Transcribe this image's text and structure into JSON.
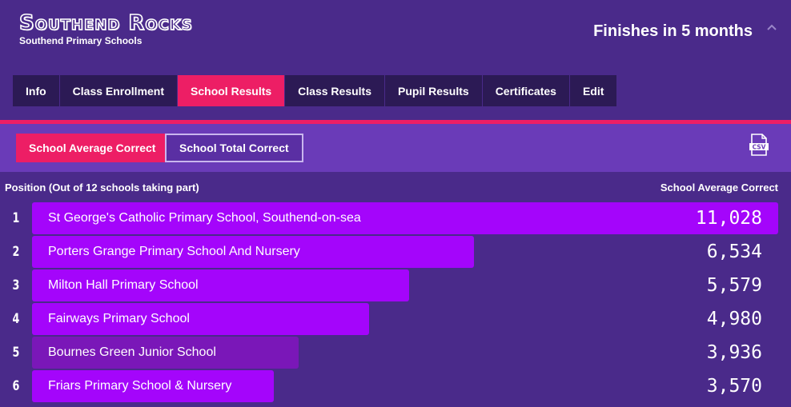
{
  "header": {
    "title": "Southend Rocks",
    "subtitle": "Southend Primary Schools",
    "finishes": "Finishes in 5 months"
  },
  "tabs": [
    {
      "label": "Info"
    },
    {
      "label": "Class Enrollment"
    },
    {
      "label": "School Results",
      "active": true
    },
    {
      "label": "Class Results"
    },
    {
      "label": "Pupil Results"
    },
    {
      "label": "Certificates"
    },
    {
      "label": "Edit"
    }
  ],
  "toolbar": {
    "average_label": "School Average Correct",
    "total_label": "School Total Correct",
    "export_icon": "csv-icon"
  },
  "list": {
    "position_header": "Position (Out of 12 schools taking part)",
    "value_header": "School Average Correct",
    "rows": [
      {
        "position": "1",
        "name": "St George's Catholic Primary School, Southend-on-sea",
        "value": "11,028",
        "amount": 11028
      },
      {
        "position": "2",
        "name": "Porters Grange Primary School And Nursery",
        "value": "6,534",
        "amount": 6534
      },
      {
        "position": "3",
        "name": "Milton Hall Primary School",
        "value": "5,579",
        "amount": 5579
      },
      {
        "position": "4",
        "name": "Fairways Primary School",
        "value": "4,980",
        "amount": 4980
      },
      {
        "position": "5",
        "name": "Bournes Green Junior School",
        "value": "3,936",
        "amount": 3936
      },
      {
        "position": "6",
        "name": "Friars Primary School & Nursery",
        "value": "3,570",
        "amount": 3570
      }
    ]
  },
  "colors": {
    "background": "#4a2a8a",
    "accent": "#ed1e65",
    "bar": "#a405fb",
    "bar_highlight": "#7a17b8",
    "tab_bg": "#2c1a55"
  }
}
